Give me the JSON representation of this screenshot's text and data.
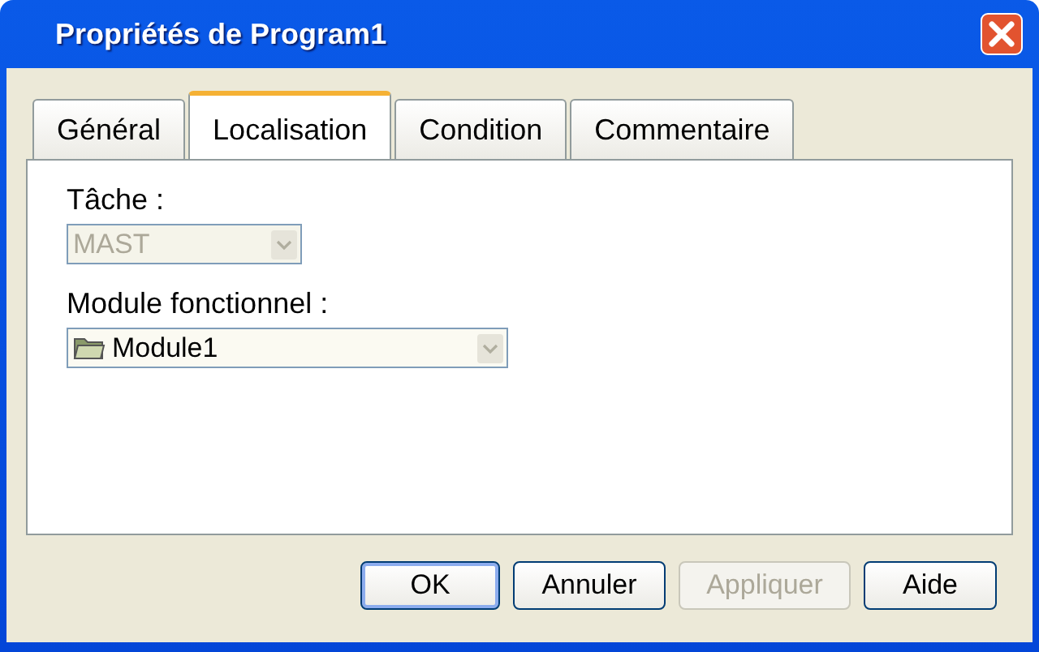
{
  "window": {
    "title": "Propriétés de Program1"
  },
  "tabs": [
    {
      "label": "Général",
      "selected": false
    },
    {
      "label": "Localisation",
      "selected": true
    },
    {
      "label": "Condition",
      "selected": false
    },
    {
      "label": "Commentaire",
      "selected": false
    }
  ],
  "fields": [
    {
      "kind": "plain",
      "label": "Tâche :",
      "value": "MAST",
      "disabled": true
    },
    {
      "kind": "folder",
      "label": "Module fonctionnel :",
      "value": "Module1",
      "disabled": false
    }
  ],
  "buttons": [
    {
      "label": "OK",
      "disabled": false,
      "default": true
    },
    {
      "label": "Annuler",
      "disabled": false,
      "default": false
    },
    {
      "label": "Appliquer",
      "disabled": true,
      "default": false
    },
    {
      "label": "Aide",
      "disabled": false,
      "default": false
    }
  ]
}
